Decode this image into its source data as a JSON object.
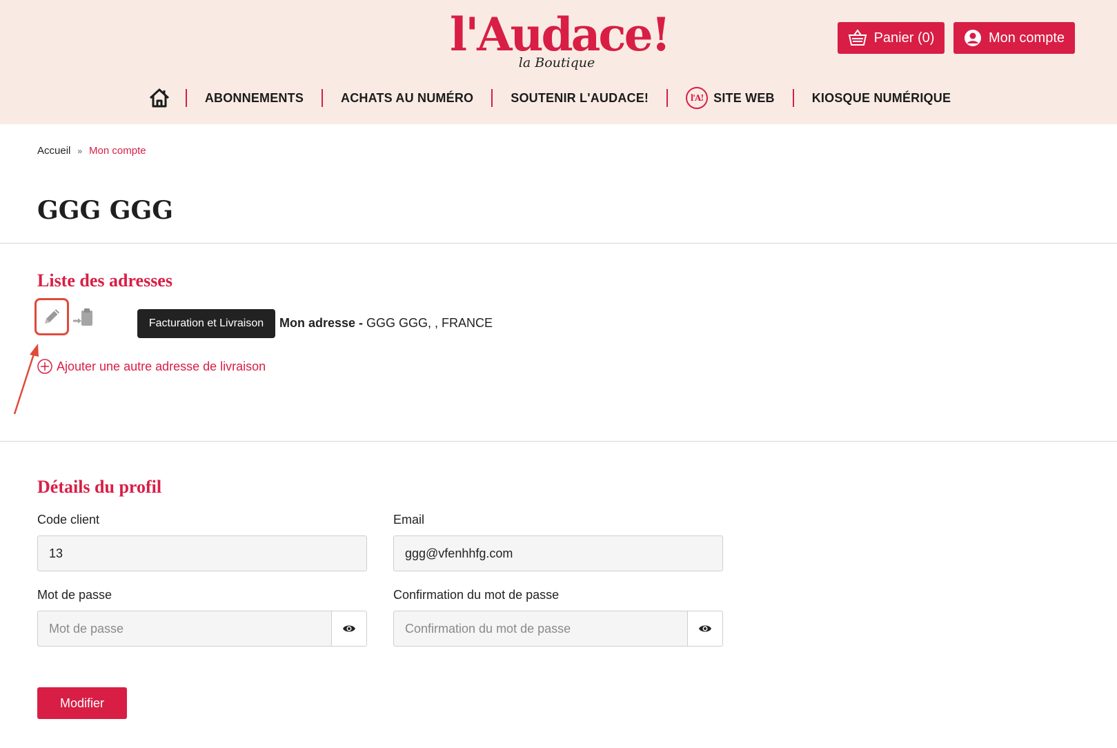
{
  "brand": {
    "logo_text": "l'Audace!",
    "logo_subtitle": "la Boutique",
    "accent_color": "#d81e45",
    "header_bg": "#f9ebe3"
  },
  "header": {
    "cart_label": "Panier (0)",
    "cart_icon": "basket-icon",
    "account_label": "Mon compte",
    "account_icon": "user-circle-icon"
  },
  "nav": {
    "home_icon": "home-icon",
    "items": [
      {
        "label": "ABONNEMENTS"
      },
      {
        "label": "ACHATS AU NUMÉRO"
      },
      {
        "label": "SOUTENIR L'AUDACE!"
      },
      {
        "label": "SITE WEB",
        "badge": "l'A!"
      },
      {
        "label": "KIOSQUE NUMÉRIQUE"
      }
    ]
  },
  "breadcrumb": {
    "home": "Accueil",
    "separator": "»",
    "current": "Mon compte"
  },
  "page": {
    "title": "GGG GGG"
  },
  "addresses": {
    "section_title": "Liste des adresses",
    "tooltip": "Facturation et Livraison",
    "items": [
      {
        "name": "Mon adresse -",
        "details": " GGG GGG, , FRANCE"
      }
    ],
    "add_label": "Ajouter une autre adresse de livraison"
  },
  "profile": {
    "section_title": "Détails du profil",
    "code_label": "Code client",
    "code_value": "13",
    "email_label": "Email",
    "email_value": "ggg@vfenhhfg.com",
    "password_label": "Mot de passe",
    "password_placeholder": "Mot de passe",
    "confirm_label": "Confirmation du mot de passe",
    "confirm_placeholder": "Confirmation du mot de passe",
    "submit_label": "Modifier"
  }
}
